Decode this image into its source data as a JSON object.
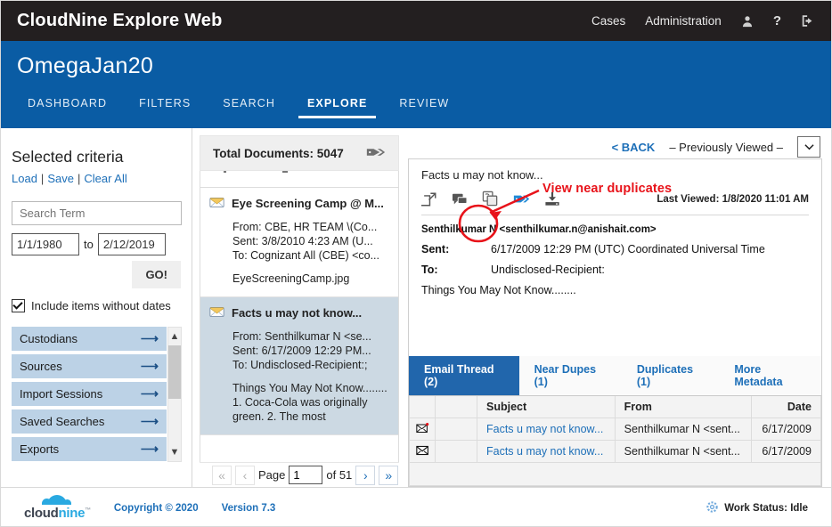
{
  "topbar": {
    "brand": "CloudNine Explore Web",
    "links": [
      {
        "label": "Cases",
        "name": "nav-cases"
      },
      {
        "label": "Administration",
        "name": "nav-administration"
      }
    ],
    "icons": [
      {
        "name": "user-icon"
      },
      {
        "name": "help-icon"
      },
      {
        "name": "logout-icon"
      }
    ]
  },
  "casebar": {
    "case_name": "OmegaJan20",
    "tabs": [
      {
        "label": "DASHBOARD",
        "active": false
      },
      {
        "label": "FILTERS",
        "active": false
      },
      {
        "label": "SEARCH",
        "active": false
      },
      {
        "label": "EXPLORE",
        "active": true
      },
      {
        "label": "REVIEW",
        "active": false
      }
    ]
  },
  "criteria": {
    "title": "Selected criteria",
    "load_label": "Load",
    "save_label": "Save",
    "clear_label": "Clear All",
    "search_placeholder": "Search Term",
    "search_value": "",
    "date_from": "1/1/1980",
    "date_to_label": "to",
    "date_to": "2/12/2019",
    "go_label": "GO!",
    "include_no_dates_label": "Include items without dates",
    "include_no_dates_checked": true,
    "facets": [
      {
        "label": "Custodians"
      },
      {
        "label": "Sources"
      },
      {
        "label": "Import Sessions"
      },
      {
        "label": "Saved Searches"
      },
      {
        "label": "Exports"
      }
    ]
  },
  "doclist": {
    "total_label": "Total Documents: 5047",
    "tag_icon": "tag-icon",
    "items": [
      {
        "subject": "Eye Screening Camp @ M...",
        "from": "From: CBE, HR TEAM \\(Co...",
        "sent": "Sent: 3/8/2010 4:23 AM (U...",
        "to": "To: Cognizant All (CBE) <co...",
        "body": "EyeScreeningCamp.jpg",
        "selected": false
      },
      {
        "subject": "Facts u may not know...",
        "from": "From: Senthilkumar N <se...",
        "sent": "Sent: 6/17/2009 12:29 PM...",
        "to": "To: Undisclosed-Recipient:;",
        "body": "Things You May Not Know........ 1. Coca-Cola was originally green. 2. The most",
        "selected": true
      }
    ],
    "pager": {
      "first": "«",
      "prev": "‹",
      "page_label": "Page",
      "page_value": "1",
      "of_label": "of 51",
      "next": "›",
      "last": "»"
    }
  },
  "viewer": {
    "back_label": "< BACK",
    "previously_viewed_label": "– Previously Viewed –",
    "dropdown_icon": "chevron-down-icon",
    "subject": "Facts u may not know...",
    "toolbar_icons": [
      {
        "name": "open-in-new-window-icon"
      },
      {
        "name": "comment-icon"
      },
      {
        "name": "near-duplicates-icon"
      },
      {
        "name": "tag-icon"
      },
      {
        "name": "download-icon"
      }
    ],
    "last_viewed": "Last Viewed: 1/8/2020 11:01 AM",
    "from_line": "Senthilkumar N <senthilkumar.n@anishait.com>",
    "sent_label": "Sent:",
    "sent_value": "6/17/2009 12:29 PM (UTC) Coordinated Universal Time",
    "to_label": "To:",
    "to_value": "Undisclosed-Recipient:",
    "snippet": "Things You May Not Know........"
  },
  "related": {
    "tabs": [
      {
        "label": "Email Thread (2)",
        "active": true
      },
      {
        "label": "Near Dupes (1)",
        "active": false
      },
      {
        "label": "Duplicates (1)",
        "active": false
      },
      {
        "label": "More Metadata",
        "active": false
      }
    ],
    "columns": [
      "",
      "",
      "Subject",
      "From",
      "Date"
    ],
    "rows": [
      {
        "icon": "envelope-with-flag-icon",
        "subject": "Facts u may not know...",
        "from": "Senthilkumar N <sent...",
        "date": "6/17/2009"
      },
      {
        "icon": "envelope-icon",
        "subject": "Facts u may not know...",
        "from": "Senthilkumar N <sent...",
        "date": "6/17/2009"
      }
    ]
  },
  "footer": {
    "logo_part1": "cloud",
    "logo_part2": "nine",
    "logo_tm": "™",
    "copyright": "Copyright © 2020",
    "version": "Version 7.3",
    "work_status": "Work Status: Idle",
    "work_status_icon": "gear-icon"
  },
  "annotation": {
    "text": "View near duplicates",
    "color": "#e8131a"
  },
  "colors": {
    "topbar_bg": "#231f20",
    "case_bg": "#0a5ca4",
    "link": "#1d6fb8",
    "facet_bg": "#bcd2e6",
    "active_tab_bg": "#2166ac",
    "annotation": "#e8131a"
  }
}
